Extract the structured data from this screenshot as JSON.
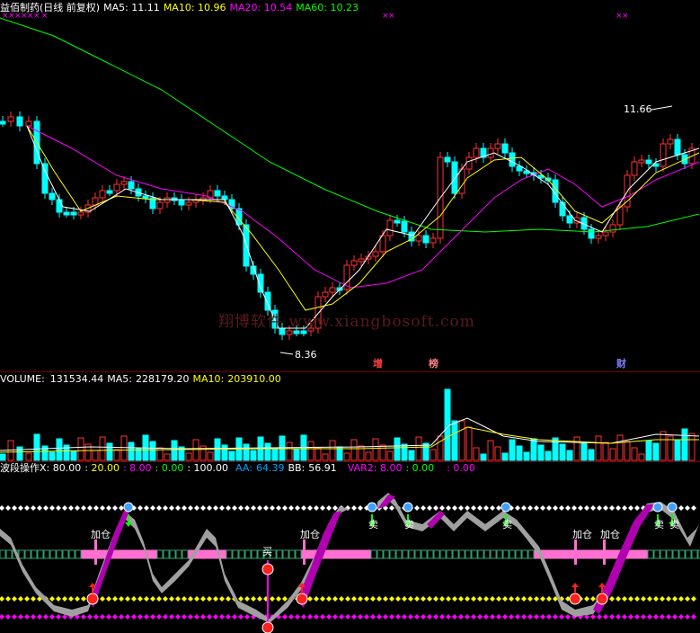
{
  "main_panel": {
    "title": "益佰制药(日线 前复权)",
    "ma_labels": [
      {
        "name": "MA5",
        "value": "11.11",
        "color": "#ffffff"
      },
      {
        "name": "MA10",
        "value": "10.96",
        "color": "#ffff00"
      },
      {
        "name": "MA20",
        "value": "10.54",
        "color": "#ff00ff"
      },
      {
        "name": "MA60",
        "value": "10.23",
        "color": "#00ff00"
      }
    ],
    "high_label": "11.66",
    "low_label": "8.36",
    "event_labels": [
      {
        "text": "增",
        "color": "#ff4040"
      },
      {
        "text": "榜",
        "color": "#ff8080"
      },
      {
        "text": "财",
        "color": "#8080ff"
      }
    ],
    "watermark": "翔博软件 www.xiangbosoft.com"
  },
  "volume_panel": {
    "label": "VOLUME",
    "value": "131534.44",
    "ma5_label": "MA5",
    "ma5_value": "228179.20",
    "ma10_label": "MA10",
    "ma10_value": "203910.00"
  },
  "indicator_panel": {
    "title": "波段操作X",
    "values": [
      {
        "text": ": 80.00",
        "color": "#ffffff"
      },
      {
        "text": ": 20.00",
        "color": "#ffff00"
      },
      {
        "text": ": 8.00",
        "color": "#ff00ff"
      },
      {
        "text": ": 0.00",
        "color": "#00ff00"
      },
      {
        "text": ": 100.00",
        "color": "#ffffff"
      }
    ],
    "aa_label": "AA",
    "aa_value": "64.39",
    "bb_label": "BB",
    "bb_value": "56.91",
    "var2_label": "VAR2",
    "var2_values": [
      ": 8.00",
      ": 0.00",
      ": 0.00"
    ],
    "signals": [
      "加仓",
      "买",
      "加仓",
      "卖",
      "卖",
      "卖",
      "加仓",
      "加仓",
      "卖",
      "卖"
    ]
  },
  "colors": {
    "up": "#ff3232",
    "down": "#00ffff",
    "ma5": "#ffffff",
    "ma10": "#ffff00",
    "ma20": "#ff00ff",
    "ma60": "#00ff00",
    "grid": "#7a0000"
  }
}
